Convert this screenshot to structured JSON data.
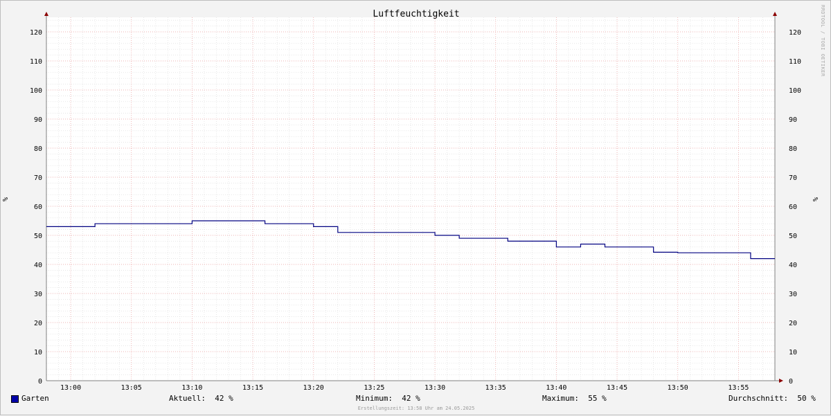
{
  "chart_data": {
    "type": "line",
    "title": "Luftfeuchtigkeit",
    "ylabel": "%",
    "ylabel_right": "%",
    "ylim": [
      0,
      125
    ],
    "yticks": [
      0,
      10,
      20,
      30,
      40,
      50,
      60,
      70,
      80,
      90,
      100,
      110,
      120
    ],
    "xlim": [
      "12:58",
      "13:58"
    ],
    "xticks": [
      "13:00",
      "13:05",
      "13:10",
      "13:15",
      "13:20",
      "13:25",
      "13:30",
      "13:35",
      "13:40",
      "13:45",
      "13:50",
      "13:55"
    ],
    "grid": true,
    "series": [
      {
        "name": "Garten",
        "color": "#000080",
        "step": true,
        "points": [
          [
            "12:58",
            53
          ],
          [
            "13:02",
            54
          ],
          [
            "13:10",
            55
          ],
          [
            "13:16",
            54
          ],
          [
            "13:20",
            53
          ],
          [
            "13:22",
            51
          ],
          [
            "13:30",
            50
          ],
          [
            "13:32",
            49
          ],
          [
            "13:36",
            48
          ],
          [
            "13:40",
            46
          ],
          [
            "13:42",
            47
          ],
          [
            "13:44",
            46
          ],
          [
            "13:48",
            44.2
          ],
          [
            "13:50",
            44
          ],
          [
            "13:56",
            42
          ],
          [
            "13:58",
            42
          ]
        ]
      }
    ]
  },
  "legend": {
    "series_name": "Garten",
    "swatch_color": "#0000a8",
    "current_label": "Aktuell:",
    "current_value": "42 %",
    "min_label": "Minimum:",
    "min_value": "42 %",
    "max_label": "Maximum:",
    "max_value": "55 %",
    "avg_label": "Durchschnitt:",
    "avg_value": "50 %"
  },
  "footer": "Erstellungszeit: 13:58 Uhr am 24.05.2025",
  "watermark": "RRDTOOL / TOBI OETIKER"
}
